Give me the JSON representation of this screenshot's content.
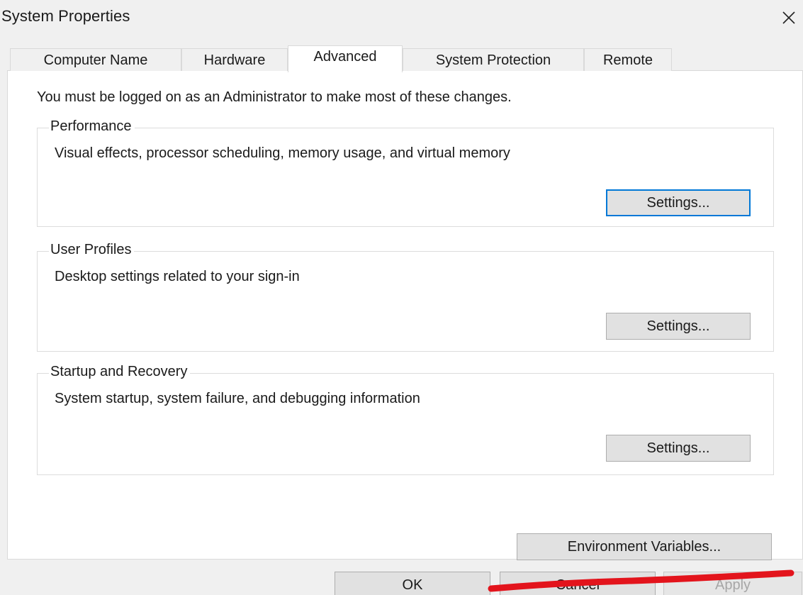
{
  "window": {
    "title": "System Properties"
  },
  "tabs": [
    {
      "label": "Computer Name",
      "active": false
    },
    {
      "label": "Hardware",
      "active": false
    },
    {
      "label": "Advanced",
      "active": true
    },
    {
      "label": "System Protection",
      "active": false
    },
    {
      "label": "Remote",
      "active": false
    }
  ],
  "advanced": {
    "admin_note": "You must be logged on as an Administrator to make most of these changes.",
    "performance": {
      "label": "Performance",
      "description": "Visual effects, processor scheduling, memory usage, and virtual memory",
      "button": "Settings..."
    },
    "user_profiles": {
      "label": "User Profiles",
      "description": "Desktop settings related to your sign-in",
      "button": "Settings..."
    },
    "startup_recovery": {
      "label": "Startup and Recovery",
      "description": "System startup, system failure, and debugging information",
      "button": "Settings..."
    },
    "env_button": "Environment Variables..."
  },
  "footer": {
    "ok": "OK",
    "cancel": "Cancel",
    "apply": "Apply"
  },
  "colors": {
    "focus_border": "#0078d7",
    "annotation_underline": "#e3141c"
  },
  "icons": {
    "close": "close-icon"
  }
}
